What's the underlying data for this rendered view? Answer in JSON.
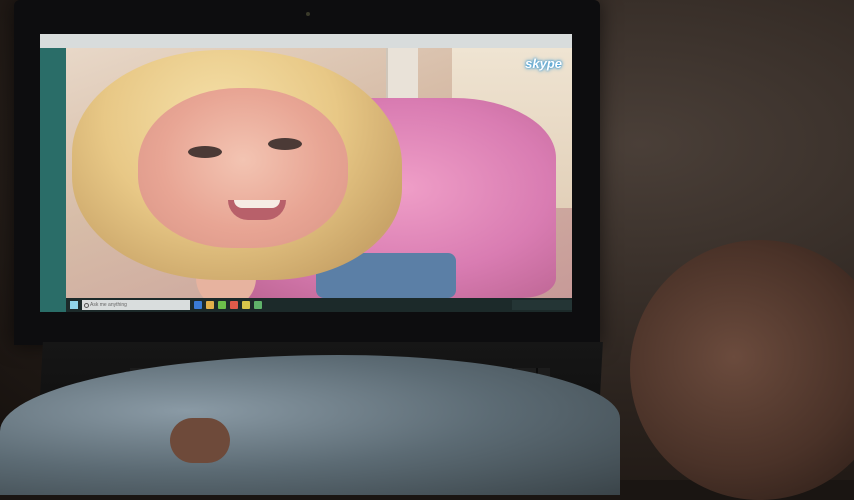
{
  "screen": {
    "window_title": "",
    "video_app_logo": "skype",
    "taskbar": {
      "search_placeholder": "Ask me anything",
      "icons": [
        "windows-start-icon",
        "edge-icon",
        "file-explorer-icon",
        "store-icon",
        "chrome-icon",
        "mail-icon",
        "skype-taskbar-icon"
      ]
    }
  },
  "colors": {
    "skype_blue": "#1f8fd6",
    "shirt_pink": "#e08ac0",
    "desktop_teal": "#2a6d68"
  }
}
